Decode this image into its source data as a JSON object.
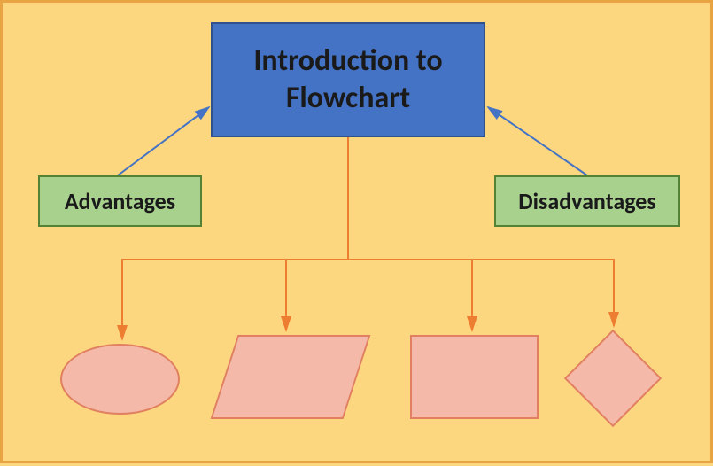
{
  "title": "Introduction to Flowchart",
  "boxes": {
    "advantages": "Advantages",
    "disadvantages": "Disadvantages"
  },
  "shapes": {
    "ellipse": "ellipse",
    "parallelogram": "parallelogram",
    "rectangle": "rectangle",
    "diamond": "diamond"
  },
  "colors": {
    "background": "#fcd77f",
    "titleBox": "#4472c4",
    "greenBox": "#a9d18e",
    "shapeFill": "#f4b9a9",
    "shapeStroke": "#e08060",
    "blueArrow": "#4472c4",
    "orangeConnector": "#ed7d31"
  }
}
